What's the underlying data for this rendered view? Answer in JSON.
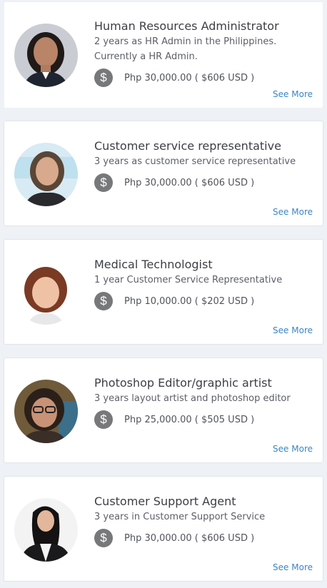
{
  "colors": {
    "background": "#eef1f5",
    "card": "#ffffff",
    "title": "#3b3f45",
    "link": "#3a86c4",
    "dollar_badge": "#77787a"
  },
  "candidates": [
    {
      "title": "Human Resources Administrator",
      "description": "2 years as HR Admin in the Philippines. Currently a HR Admin.",
      "currency_icon": "dollar-icon",
      "salary": "Php 30,000.00 ( $606 USD )",
      "see_more": "See More"
    },
    {
      "title": "Customer service representative",
      "description": "3 years as customer service representative",
      "currency_icon": "dollar-icon",
      "salary": "Php 30,000.00 ( $606 USD )",
      "see_more": "See More"
    },
    {
      "title": "Medical Technologist",
      "description": "1 year Customer Service Representative",
      "currency_icon": "dollar-icon",
      "salary": "Php 10,000.00 ( $202 USD )",
      "see_more": "See More"
    },
    {
      "title": "Photoshop Editor/graphic artist",
      "description": "3 years layout artist and photoshop editor",
      "currency_icon": "dollar-icon",
      "salary": "Php 25,000.00 ( $505 USD )",
      "see_more": "See More"
    },
    {
      "title": "Customer Support Agent",
      "description": "3 years in Customer Support Service",
      "currency_icon": "dollar-icon",
      "salary": "Php 30,000.00 ( $606 USD )",
      "see_more": "See More"
    }
  ]
}
